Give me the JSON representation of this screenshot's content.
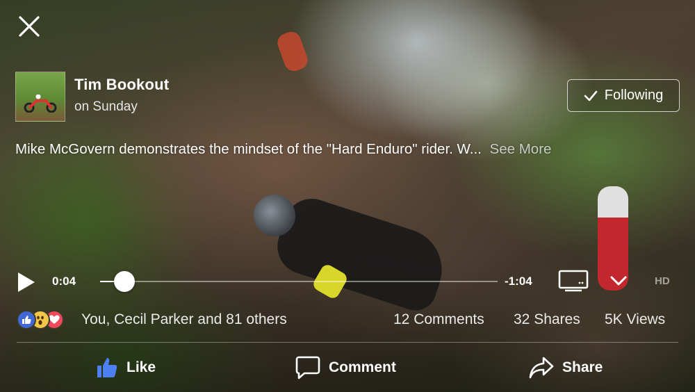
{
  "post": {
    "author": "Tim Bookout",
    "time": "on Sunday",
    "follow_label": "Following",
    "caption": "Mike McGovern demonstrates the mindset of the \"Hard Enduro\" rider.  W...",
    "see_more": "See More"
  },
  "player": {
    "current_time": "0:04",
    "remaining_time": "-1:04",
    "progress": 0.062,
    "quality": "HD"
  },
  "engagement": {
    "reactions_text": "You, Cecil Parker and 81 others",
    "comments": "12 Comments",
    "shares": "32 Shares",
    "views": "5K Views",
    "reaction_icons": [
      "like-icon",
      "wow-icon",
      "love-icon"
    ]
  },
  "actions": {
    "like": "Like",
    "comment": "Comment",
    "share": "Share"
  },
  "colors": {
    "like_blue": "#4267d6",
    "wow_yellow": "#f4c64a",
    "love_red": "#ef4a5c"
  }
}
